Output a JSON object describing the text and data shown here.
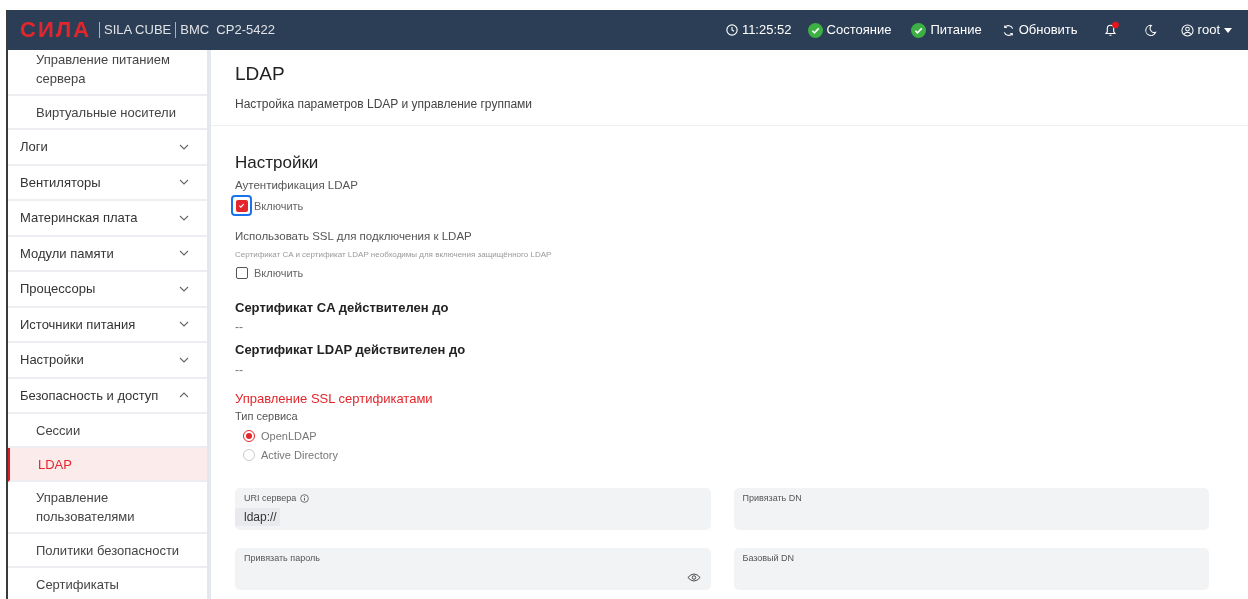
{
  "header": {
    "logo": "СИЛА",
    "product": "SILA CUBE",
    "model": "BMC  CP2-5422",
    "time": "11:25:52",
    "status_items": [
      {
        "label": "Состояние",
        "ok": true
      },
      {
        "label": "Питание",
        "ok": true
      }
    ],
    "refresh": "Обновить",
    "notifications": {
      "unread": true
    },
    "user": "root"
  },
  "sidebar": {
    "items": [
      {
        "kind": "child",
        "label": "Управление питанием сервера",
        "selected": false
      },
      {
        "kind": "child",
        "label": "Виртуальные носители",
        "selected": false
      },
      {
        "kind": "group",
        "label": "Логи",
        "expanded": false
      },
      {
        "kind": "group",
        "label": "Вентиляторы",
        "expanded": false
      },
      {
        "kind": "group",
        "label": "Материнская плата",
        "expanded": false
      },
      {
        "kind": "group",
        "label": "Модули памяти",
        "expanded": false
      },
      {
        "kind": "group",
        "label": "Процессоры",
        "expanded": false
      },
      {
        "kind": "group",
        "label": "Источники питания",
        "expanded": false
      },
      {
        "kind": "group",
        "label": "Настройки",
        "expanded": false
      },
      {
        "kind": "group",
        "label": "Безопасность и доступ",
        "expanded": true,
        "children": [
          {
            "label": "Сессии",
            "selected": false
          },
          {
            "label": "LDAP",
            "selected": true
          },
          {
            "label": "Управление пользователями",
            "selected": false
          },
          {
            "label": "Политики безопасности",
            "selected": false
          },
          {
            "label": "Сертификаты",
            "selected": false
          }
        ]
      }
    ]
  },
  "page": {
    "title": "LDAP",
    "subtitle": "Настройка параметров LDAP и управление группами"
  },
  "settings": {
    "heading": "Настройки",
    "ldap_auth": {
      "label": "Аутентификация LDAP",
      "checkbox": {
        "label": "Включить",
        "checked": true,
        "focused": true
      }
    },
    "ssl": {
      "label": "Использовать SSL для подключения к LDAP",
      "hint": "Сертификат CA и сертификат LDAP необходимы для включения защищённого LDAP",
      "checkbox": {
        "label": "Включить",
        "checked": false,
        "focused": false
      }
    },
    "certs": [
      {
        "label": "Сертификат CA действителен до",
        "value": "--"
      },
      {
        "label": "Сертификат LDAP действителен до",
        "value": "--"
      }
    ],
    "ssl_link": "Управление SSL сертификатами",
    "service_type": {
      "label": "Тип сервиса",
      "options": [
        {
          "label": "OpenLDAP",
          "selected": true
        },
        {
          "label": "Active Directory",
          "selected": false
        }
      ]
    },
    "fields": [
      {
        "label": "URI сервера",
        "info": true,
        "prefix": "ldap://",
        "password": false
      },
      {
        "label": "Привязать DN",
        "info": false,
        "password": false
      },
      {
        "label": "Привязать пароль",
        "info": false,
        "password": true
      },
      {
        "label": "Базовый DN",
        "info": false,
        "password": false
      }
    ]
  }
}
